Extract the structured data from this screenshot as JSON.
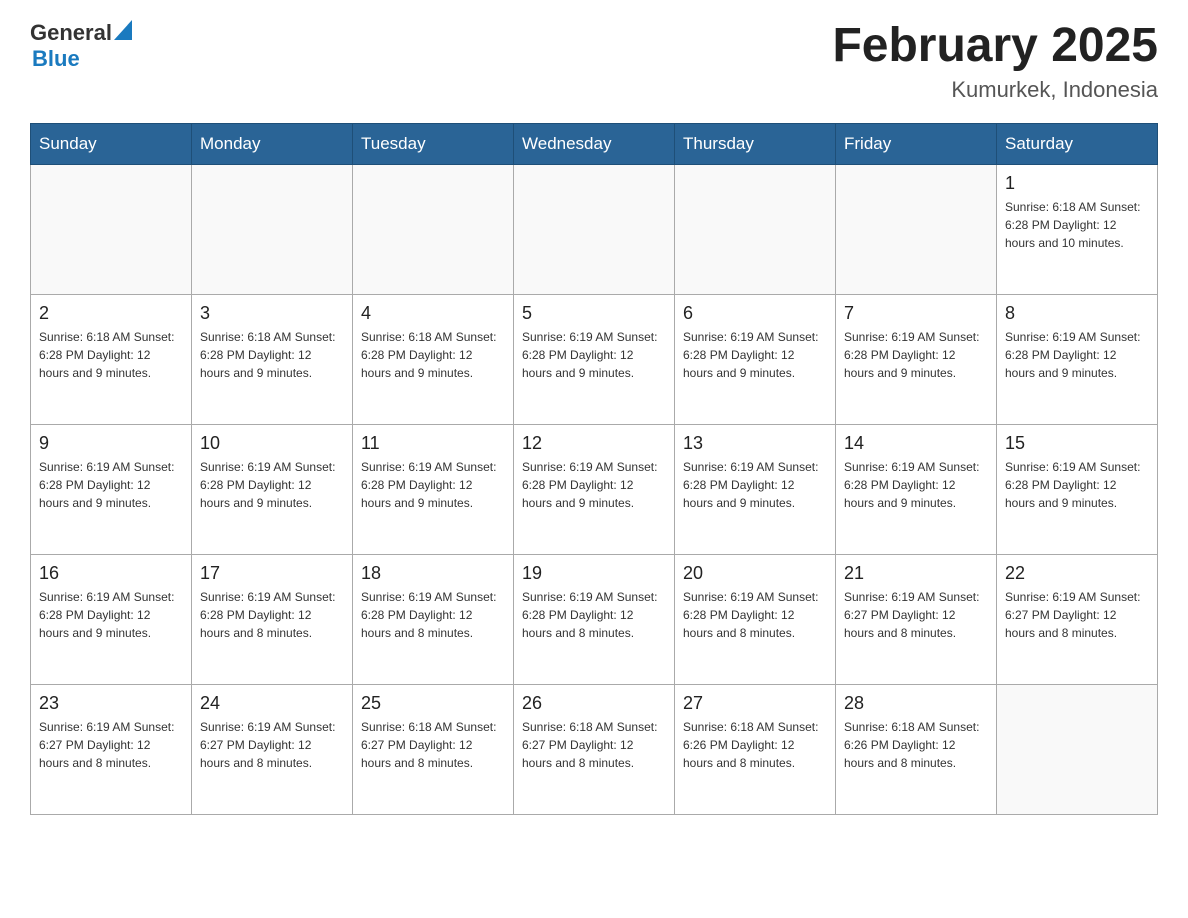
{
  "header": {
    "logo_general": "General",
    "logo_blue": "Blue",
    "title": "February 2025",
    "subtitle": "Kumurkek, Indonesia"
  },
  "weekdays": [
    "Sunday",
    "Monday",
    "Tuesday",
    "Wednesday",
    "Thursday",
    "Friday",
    "Saturday"
  ],
  "weeks": [
    [
      {
        "day": "",
        "info": ""
      },
      {
        "day": "",
        "info": ""
      },
      {
        "day": "",
        "info": ""
      },
      {
        "day": "",
        "info": ""
      },
      {
        "day": "",
        "info": ""
      },
      {
        "day": "",
        "info": ""
      },
      {
        "day": "1",
        "info": "Sunrise: 6:18 AM\nSunset: 6:28 PM\nDaylight: 12 hours and 10 minutes."
      }
    ],
    [
      {
        "day": "2",
        "info": "Sunrise: 6:18 AM\nSunset: 6:28 PM\nDaylight: 12 hours and 9 minutes."
      },
      {
        "day": "3",
        "info": "Sunrise: 6:18 AM\nSunset: 6:28 PM\nDaylight: 12 hours and 9 minutes."
      },
      {
        "day": "4",
        "info": "Sunrise: 6:18 AM\nSunset: 6:28 PM\nDaylight: 12 hours and 9 minutes."
      },
      {
        "day": "5",
        "info": "Sunrise: 6:19 AM\nSunset: 6:28 PM\nDaylight: 12 hours and 9 minutes."
      },
      {
        "day": "6",
        "info": "Sunrise: 6:19 AM\nSunset: 6:28 PM\nDaylight: 12 hours and 9 minutes."
      },
      {
        "day": "7",
        "info": "Sunrise: 6:19 AM\nSunset: 6:28 PM\nDaylight: 12 hours and 9 minutes."
      },
      {
        "day": "8",
        "info": "Sunrise: 6:19 AM\nSunset: 6:28 PM\nDaylight: 12 hours and 9 minutes."
      }
    ],
    [
      {
        "day": "9",
        "info": "Sunrise: 6:19 AM\nSunset: 6:28 PM\nDaylight: 12 hours and 9 minutes."
      },
      {
        "day": "10",
        "info": "Sunrise: 6:19 AM\nSunset: 6:28 PM\nDaylight: 12 hours and 9 minutes."
      },
      {
        "day": "11",
        "info": "Sunrise: 6:19 AM\nSunset: 6:28 PM\nDaylight: 12 hours and 9 minutes."
      },
      {
        "day": "12",
        "info": "Sunrise: 6:19 AM\nSunset: 6:28 PM\nDaylight: 12 hours and 9 minutes."
      },
      {
        "day": "13",
        "info": "Sunrise: 6:19 AM\nSunset: 6:28 PM\nDaylight: 12 hours and 9 minutes."
      },
      {
        "day": "14",
        "info": "Sunrise: 6:19 AM\nSunset: 6:28 PM\nDaylight: 12 hours and 9 minutes."
      },
      {
        "day": "15",
        "info": "Sunrise: 6:19 AM\nSunset: 6:28 PM\nDaylight: 12 hours and 9 minutes."
      }
    ],
    [
      {
        "day": "16",
        "info": "Sunrise: 6:19 AM\nSunset: 6:28 PM\nDaylight: 12 hours and 9 minutes."
      },
      {
        "day": "17",
        "info": "Sunrise: 6:19 AM\nSunset: 6:28 PM\nDaylight: 12 hours and 8 minutes."
      },
      {
        "day": "18",
        "info": "Sunrise: 6:19 AM\nSunset: 6:28 PM\nDaylight: 12 hours and 8 minutes."
      },
      {
        "day": "19",
        "info": "Sunrise: 6:19 AM\nSunset: 6:28 PM\nDaylight: 12 hours and 8 minutes."
      },
      {
        "day": "20",
        "info": "Sunrise: 6:19 AM\nSunset: 6:28 PM\nDaylight: 12 hours and 8 minutes."
      },
      {
        "day": "21",
        "info": "Sunrise: 6:19 AM\nSunset: 6:27 PM\nDaylight: 12 hours and 8 minutes."
      },
      {
        "day": "22",
        "info": "Sunrise: 6:19 AM\nSunset: 6:27 PM\nDaylight: 12 hours and 8 minutes."
      }
    ],
    [
      {
        "day": "23",
        "info": "Sunrise: 6:19 AM\nSunset: 6:27 PM\nDaylight: 12 hours and 8 minutes."
      },
      {
        "day": "24",
        "info": "Sunrise: 6:19 AM\nSunset: 6:27 PM\nDaylight: 12 hours and 8 minutes."
      },
      {
        "day": "25",
        "info": "Sunrise: 6:18 AM\nSunset: 6:27 PM\nDaylight: 12 hours and 8 minutes."
      },
      {
        "day": "26",
        "info": "Sunrise: 6:18 AM\nSunset: 6:27 PM\nDaylight: 12 hours and 8 minutes."
      },
      {
        "day": "27",
        "info": "Sunrise: 6:18 AM\nSunset: 6:26 PM\nDaylight: 12 hours and 8 minutes."
      },
      {
        "day": "28",
        "info": "Sunrise: 6:18 AM\nSunset: 6:26 PM\nDaylight: 12 hours and 8 minutes."
      },
      {
        "day": "",
        "info": ""
      }
    ]
  ]
}
